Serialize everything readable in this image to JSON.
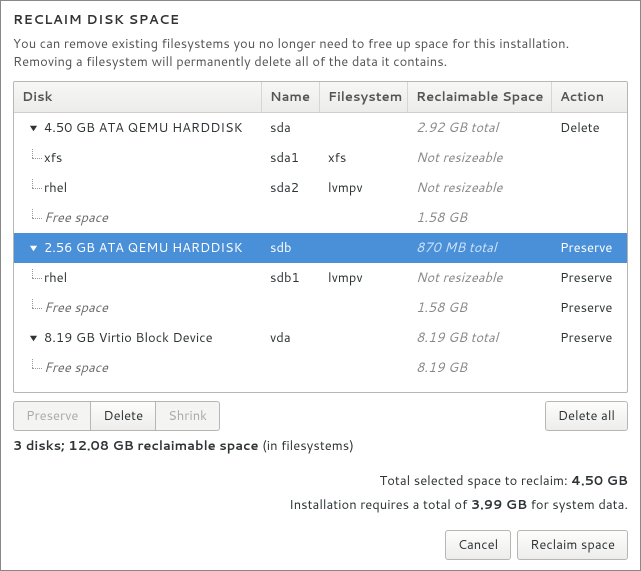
{
  "title": "RECLAIM DISK SPACE",
  "description": "You can remove existing filesystems you no longer need to free up space for this installation. Removing a filesystem will permanently delete all of the data it contains.",
  "columns": {
    "disk": "Disk",
    "name": "Name",
    "fs": "Filesystem",
    "recl": "Reclaimable Space",
    "act": "Action"
  },
  "rows": [
    {
      "level": 0,
      "exp": true,
      "disk": "4.50 GB ATA QEMU HARDDISK",
      "name": "sda",
      "fs": "",
      "recl": "2.92 GB total",
      "act": "Delete",
      "italic": false,
      "selected": false
    },
    {
      "level": 1,
      "exp": false,
      "disk": "xfs",
      "name": "sda1",
      "fs": "xfs",
      "recl": "Not resizeable",
      "act": "",
      "italic": false,
      "selected": false
    },
    {
      "level": 1,
      "exp": false,
      "disk": "rhel",
      "name": "sda2",
      "fs": "lvmpv",
      "recl": "Not resizeable",
      "act": "",
      "italic": false,
      "selected": false
    },
    {
      "level": 1,
      "exp": false,
      "disk": "Free space",
      "name": "",
      "fs": "",
      "recl": "1.58 GB",
      "act": "",
      "italic": true,
      "selected": false
    },
    {
      "level": 0,
      "exp": true,
      "disk": "2.56 GB ATA QEMU HARDDISK",
      "name": "sdb",
      "fs": "",
      "recl": "870 MB total",
      "act": "Preserve",
      "italic": false,
      "selected": true
    },
    {
      "level": 1,
      "exp": false,
      "disk": "rhel",
      "name": "sdb1",
      "fs": "lvmpv",
      "recl": "Not resizeable",
      "act": "Preserve",
      "italic": false,
      "selected": false
    },
    {
      "level": 1,
      "exp": false,
      "disk": "Free space",
      "name": "",
      "fs": "",
      "recl": "1.58 GB",
      "act": "Preserve",
      "italic": true,
      "selected": false
    },
    {
      "level": 0,
      "exp": true,
      "disk": "8.19 GB Virtio Block Device",
      "name": "vda",
      "fs": "",
      "recl": "8.19 GB total",
      "act": "Preserve",
      "italic": false,
      "selected": false
    },
    {
      "level": 1,
      "exp": false,
      "disk": "Free space",
      "name": "",
      "fs": "",
      "recl": "8.19 GB",
      "act": "",
      "italic": true,
      "selected": false
    }
  ],
  "toolbar": {
    "preserve": "Preserve",
    "delete": "Delete",
    "shrink": "Shrink",
    "delete_all": "Delete all"
  },
  "summary": {
    "bold": "3 disks; 12.08 GB reclaimable space",
    "rest": " (in filesystems)"
  },
  "selected_line": {
    "pre": "Total selected space to reclaim: ",
    "val": "4.50 GB"
  },
  "required_line": {
    "pre": "Installation requires a total of ",
    "val": "3.99 GB",
    "post": " for system data."
  },
  "footer": {
    "cancel": "Cancel",
    "reclaim": "Reclaim space"
  }
}
